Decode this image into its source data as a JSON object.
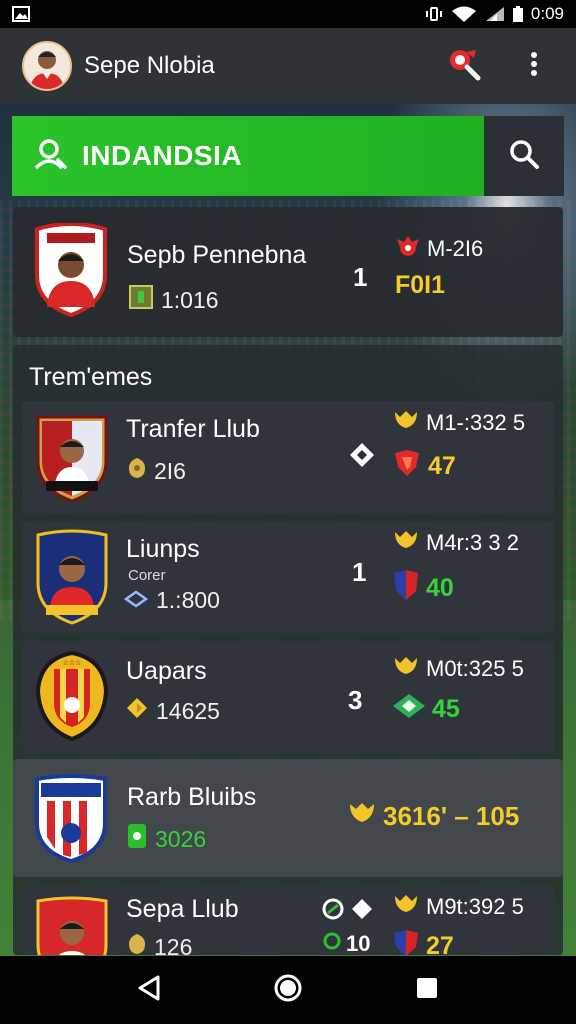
{
  "status_bar": {
    "time": "0:09"
  },
  "header": {
    "title": "Sepe Nlobia"
  },
  "search": {
    "label": "INDANDSIA"
  },
  "featured": {
    "name": "Sepb Pennebna",
    "sub_value": "1:016",
    "rank": "1",
    "score_top": "M-2I6",
    "score_bottom": "F0I1"
  },
  "list": {
    "title": "Trem'emes",
    "rows": [
      {
        "name": "Tranfer Llub",
        "sub_value": "2I6",
        "score_top": "M1-:332 5",
        "score_bottom": "47"
      },
      {
        "name": "Liunps",
        "note": "Corer",
        "sub_value": "1.:800",
        "rank": "1",
        "score_top": "M4r:3 3  2",
        "score_bottom": "40"
      },
      {
        "name": "Uapars",
        "sub_value": "14625",
        "rank": "3",
        "score_top": "M0t:325 5",
        "score_bottom": "45"
      },
      {
        "name": "Rarb Bluibs",
        "sub_value": "3026",
        "big_score": "3616' – 105"
      },
      {
        "name": "Sepa Llub",
        "sub_value": "126",
        "rank": "10",
        "score_top": "M9t:392 5",
        "score_bottom": "27"
      }
    ]
  },
  "colors": {
    "accent_green": "#2bc42b",
    "score_yellow": "#f4cc2e",
    "score_green": "#38d23a",
    "card": "#282c31"
  },
  "icons": [
    "photo-icon",
    "vibrate-icon",
    "wifi-icon",
    "signal-icon",
    "battery-icon",
    "avatar",
    "search-tag-icon",
    "more-vert-icon",
    "user-search-icon",
    "search-icon",
    "back-icon",
    "home-icon",
    "recents-icon"
  ]
}
